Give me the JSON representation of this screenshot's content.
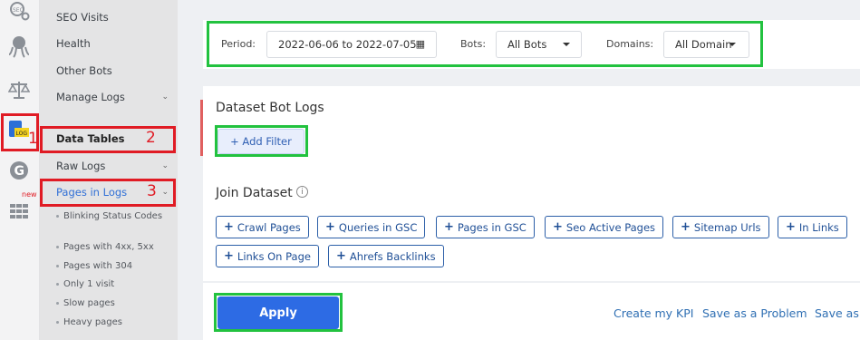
{
  "rail": {
    "icons": [
      "seo-bulb-icon",
      "octopus-icon",
      "scales-icon",
      "log-icon",
      "g-circle-icon",
      "table-grid-icon"
    ],
    "new_badge": "new"
  },
  "sidebar": {
    "items": [
      {
        "label": "SEO Visits"
      },
      {
        "label": "Health"
      },
      {
        "label": "Other Bots"
      },
      {
        "label": "Manage Logs"
      },
      {
        "label": "Data Tables"
      },
      {
        "label": "Raw Logs"
      },
      {
        "label": "Pages in Logs"
      }
    ],
    "subitems": [
      "Blinking Status Codes",
      "Pages with 4xx, 5xx",
      "Pages with 304",
      "Only 1 visit",
      "Slow pages",
      "Heavy pages"
    ]
  },
  "annotations": [
    "1",
    "2",
    "3"
  ],
  "filters": {
    "period_label": "Period:",
    "period_value": "2022-06-06 to 2022-07-05",
    "bots_label": "Bots:",
    "bots_value": "All Bots",
    "domains_label": "Domains:",
    "domains_value": "All Domains"
  },
  "dataset": {
    "title": "Dataset Bot Logs",
    "add_filter": "+ Add Filter",
    "join_title": "Join Dataset",
    "join_buttons": [
      "Crawl Pages",
      "Queries in GSC",
      "Pages in GSC",
      "Seo Active Pages",
      "Sitemap Urls",
      "In Links",
      "Links On Page",
      "Ahrefs Backlinks"
    ]
  },
  "footer": {
    "apply": "Apply",
    "create_kpi": "Create my KPI",
    "save_problem": "Save as a Problem",
    "save_as": "Save as"
  }
}
